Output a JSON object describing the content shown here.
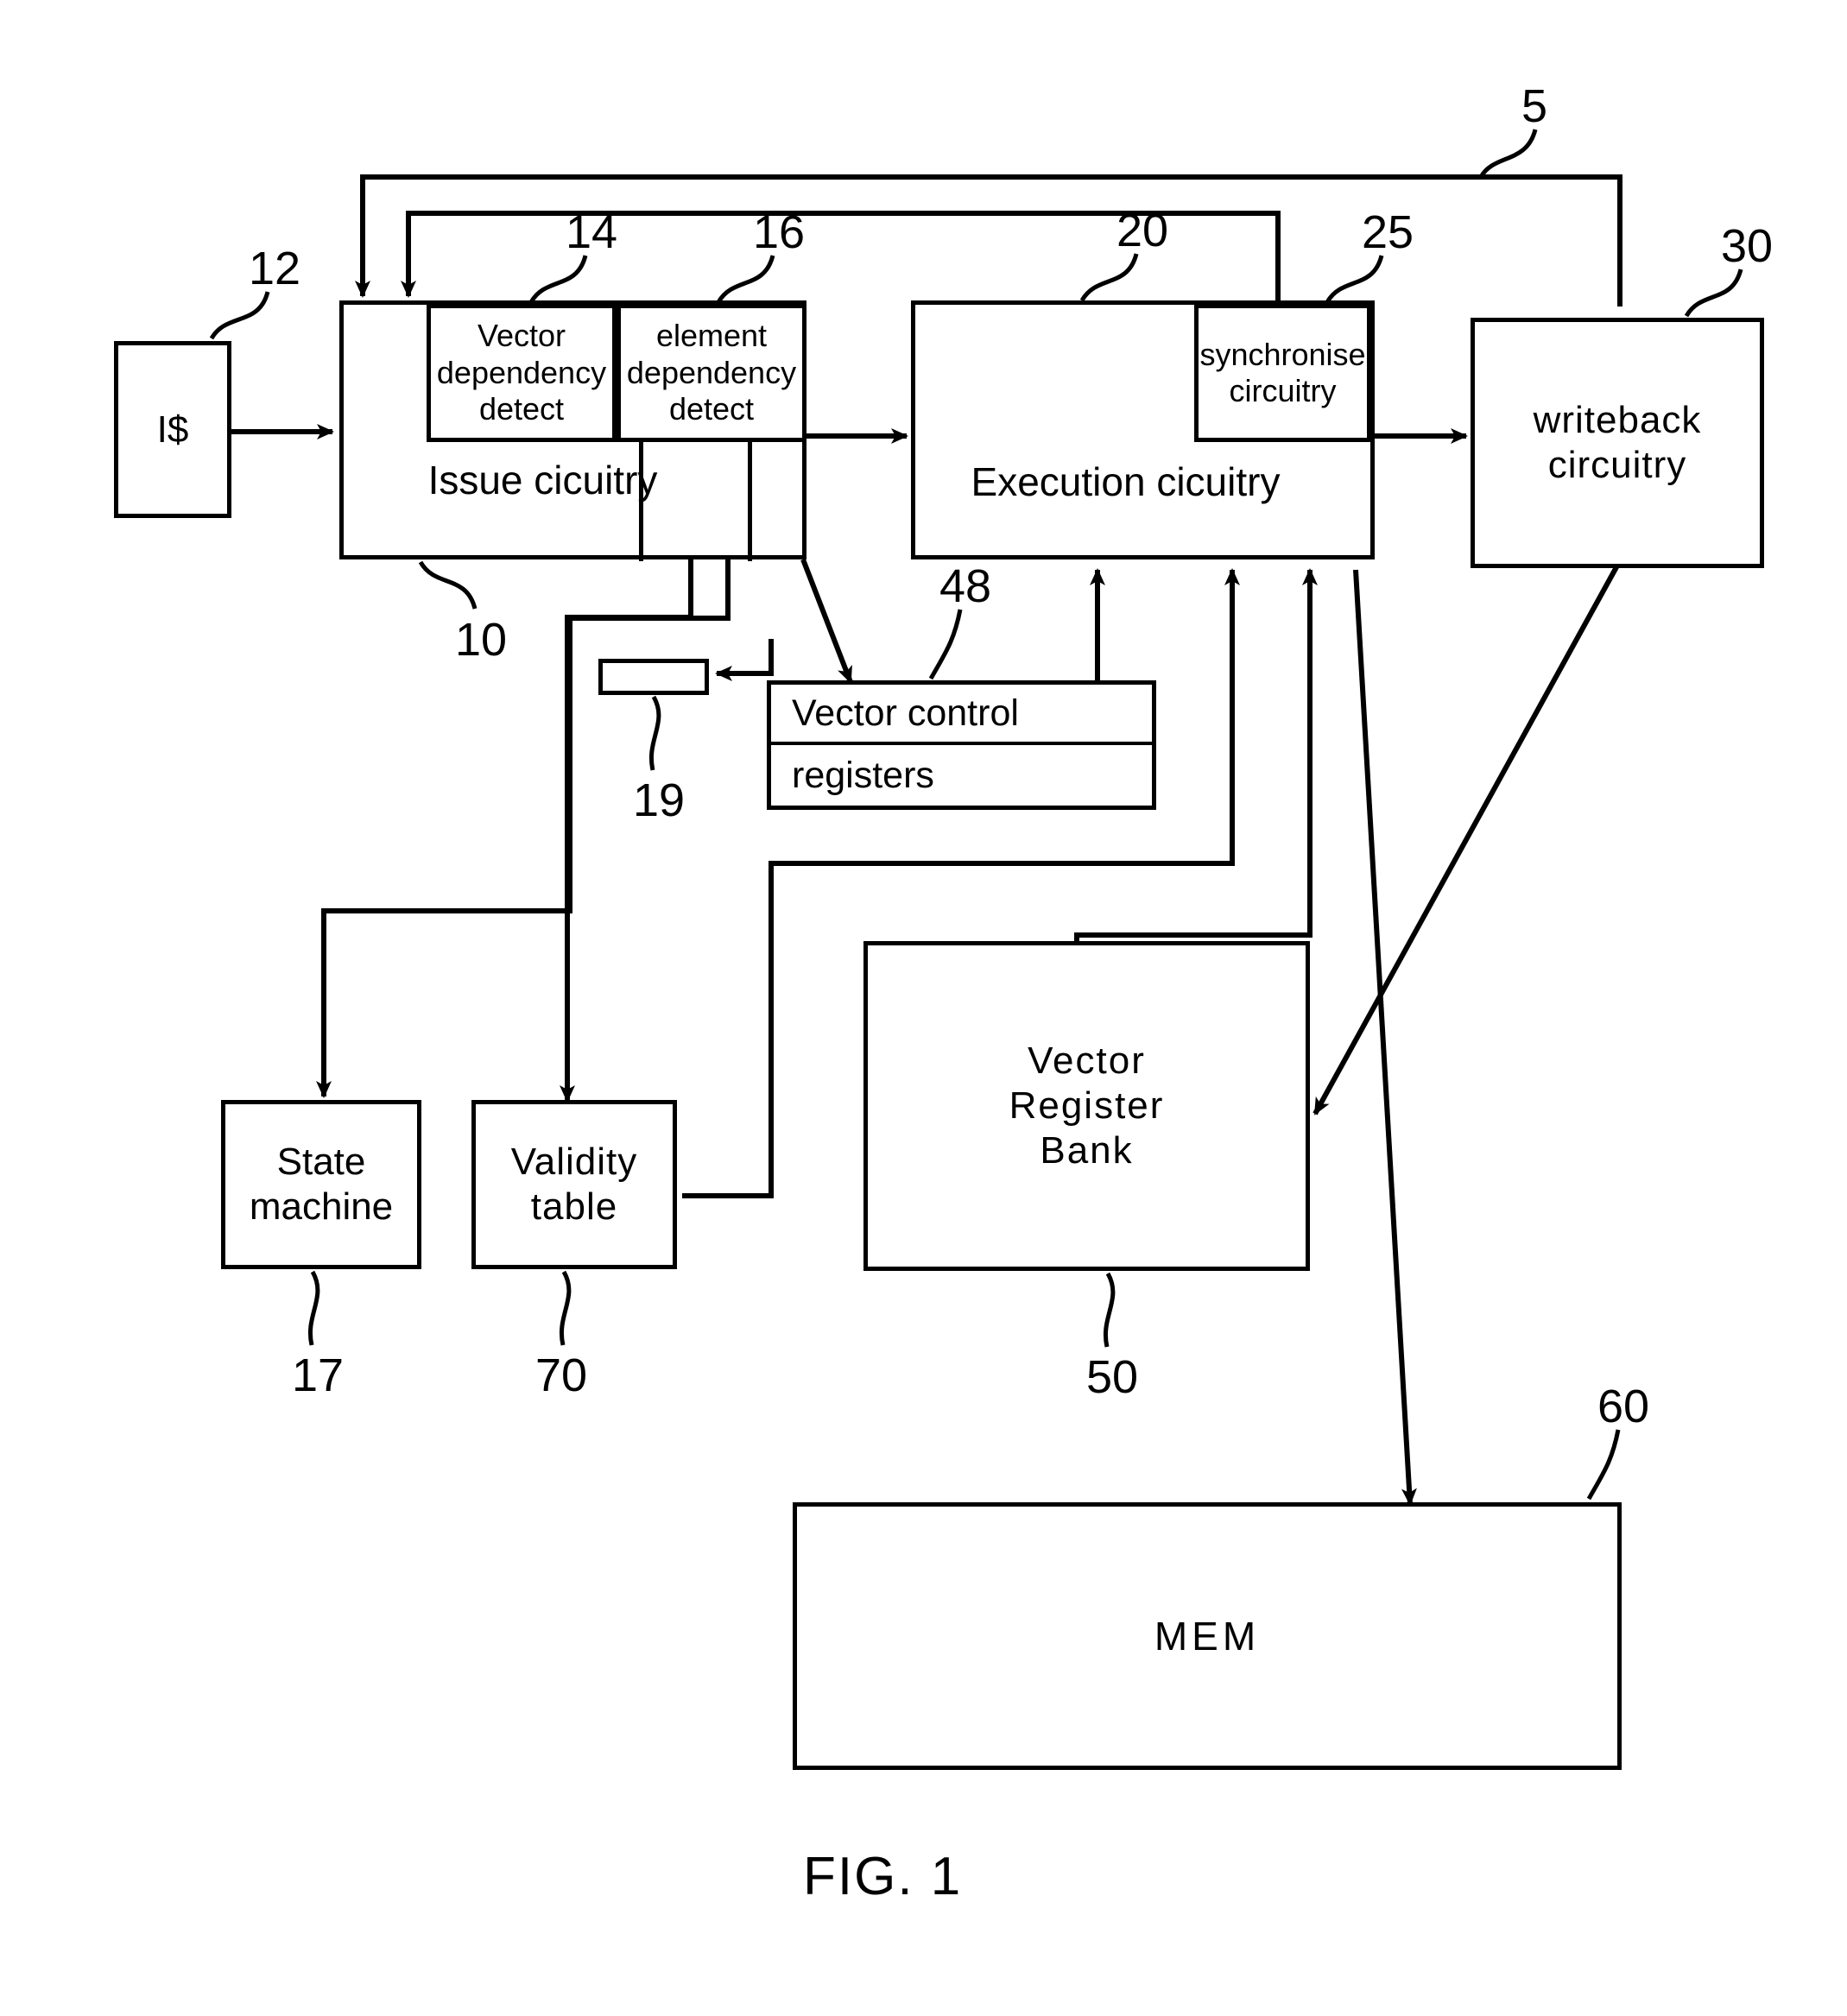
{
  "figure": {
    "caption": "FIG. 1",
    "system_ref": "5"
  },
  "blocks": {
    "icache": {
      "label": "I$",
      "ref": "12"
    },
    "issue_circuitry": {
      "label": "Issue cicuitry",
      "ref": "10"
    },
    "vector_dependency_detect": {
      "label": "Vector\ndependency\ndetect",
      "ref": "14"
    },
    "element_dependency_detect": {
      "label": "element\ndependency\ndetect",
      "ref": "16"
    },
    "execution_circuitry": {
      "label": "Execution cicuitry",
      "ref": "20"
    },
    "synchronise_circuitry": {
      "label": "synchronise\ncircuitry",
      "ref": "25"
    },
    "writeback_circuitry": {
      "label": "writeback\ncircuitry",
      "ref": "30"
    },
    "small_register": {
      "label": "",
      "ref": "19"
    },
    "vector_control_registers": {
      "label_line1": "Vector control",
      "label_line2": "registers",
      "ref": "48"
    },
    "state_machine": {
      "label": "State\nmachine",
      "ref": "17"
    },
    "validity_table": {
      "label": "Validity\ntable",
      "ref": "70"
    },
    "vector_register_bank": {
      "label": "Vector\nRegister\nBank",
      "ref": "50"
    },
    "memory": {
      "label": "MEM",
      "ref": "60"
    }
  }
}
